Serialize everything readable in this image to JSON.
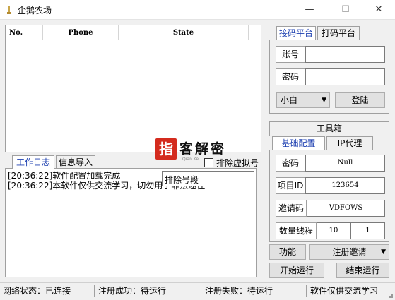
{
  "window": {
    "title": "企鹅农场",
    "minimize_glyph": "—",
    "maximize_glyph": "☐",
    "close_glyph": "✕"
  },
  "table": {
    "columns": [
      "No.",
      "Phone",
      "State"
    ]
  },
  "log_tabs": {
    "work_log": "工作日志",
    "info_import": "信息导入"
  },
  "log": {
    "lines": [
      "[20:36:22]软件配置加载完成",
      "[20:36:22]本软件仅供交流学习，切勿用于非法途径"
    ]
  },
  "exclude": {
    "number_segment_label": "排除号段",
    "virtual_checkbox_label": "排除虚拟号",
    "virtual_checked": false
  },
  "watermark": {
    "mark": "指",
    "text": "客解密",
    "sub": "Qian Kè"
  },
  "platform_tabs": {
    "code_platform": "接码平台",
    "captcha_platform": "打码平台"
  },
  "login": {
    "account_label": "账号",
    "account_value": "",
    "password_label": "密码",
    "password_value": "",
    "platform_select": "小白",
    "login_button": "登陆"
  },
  "toolbox": {
    "header": "工具箱",
    "tab_basic": "基础配置",
    "tab_proxy": "IP代理"
  },
  "config": {
    "password_label": "密码",
    "password_value": "Null",
    "project_id_label": "项目ID",
    "project_id_value": "123654",
    "invite_code_label": "邀请码",
    "invite_code_value": "VDFOWS",
    "threads_label": "数量线程",
    "quantity_value": "10",
    "threads_value": "1"
  },
  "actions": {
    "function_button": "功能",
    "register_invite_select": "注册邀请",
    "start_button": "开始运行",
    "stop_button": "结束运行"
  },
  "status": {
    "network": "网络状态：已连接",
    "register_success": "注册成功：待运行",
    "register_fail": "注册失败：待运行",
    "notice": "软件仅供交流学习"
  },
  "colors": {
    "accent_tab_text": "#1c3fb0",
    "logo_red": "#d42b1e",
    "panel_bg": "#f0f0f0"
  }
}
